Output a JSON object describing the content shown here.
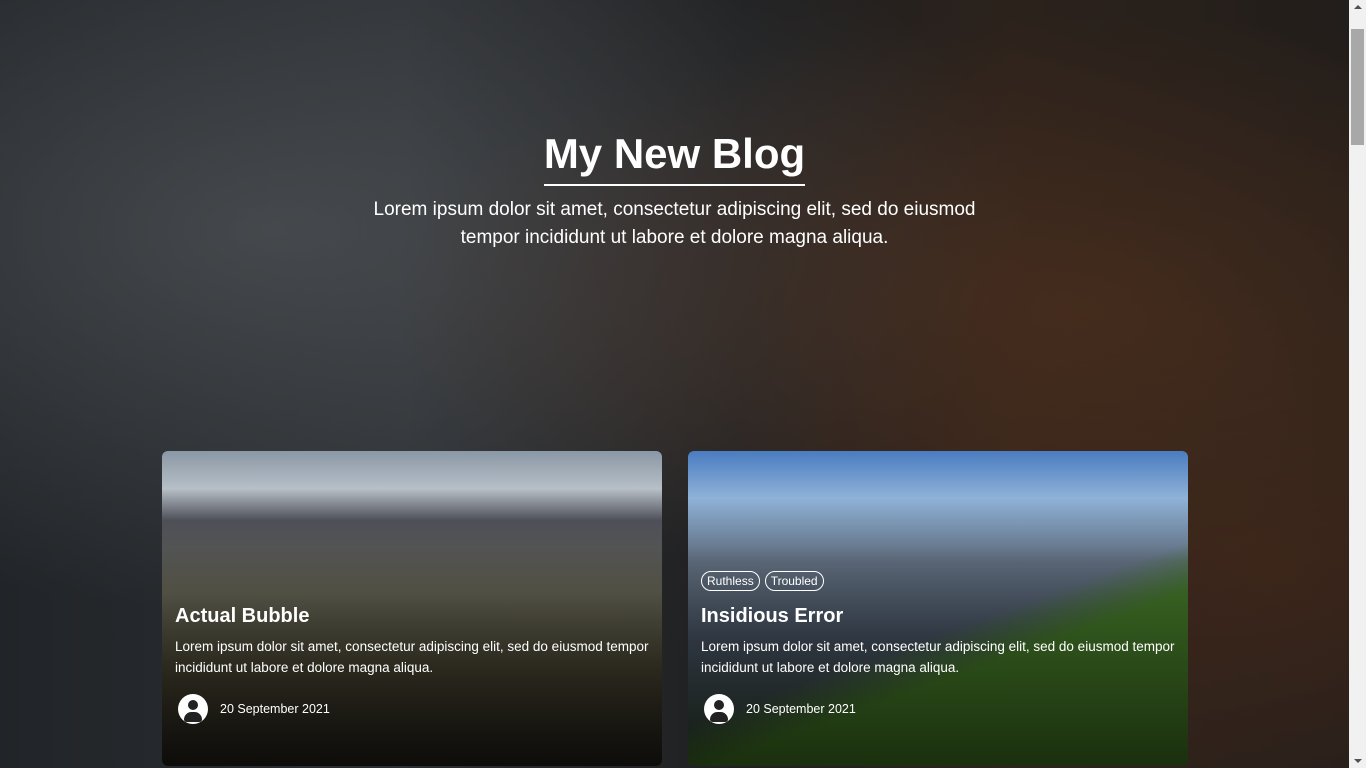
{
  "header": {
    "title": "My New Blog",
    "subtitle": "Lorem ipsum dolor sit amet, consectetur adipiscing elit, sed do eiusmod tempor incididunt ut labore et dolore magna aliqua."
  },
  "posts": [
    {
      "title": "Actual Bubble",
      "excerpt": "Lorem ipsum dolor sit amet, consectetur adipiscing elit, sed do eiusmod tempor incididunt ut labore et dolore magna aliqua.",
      "date": "20 September 2021",
      "tags": []
    },
    {
      "title": "Insidious Error",
      "excerpt": "Lorem ipsum dolor sit amet, consectetur adipiscing elit, sed do eiusmod tempor incididunt ut labore et dolore magna aliqua.",
      "date": "20 September 2021",
      "tags": [
        "Ruthless",
        "Troubled"
      ]
    }
  ]
}
